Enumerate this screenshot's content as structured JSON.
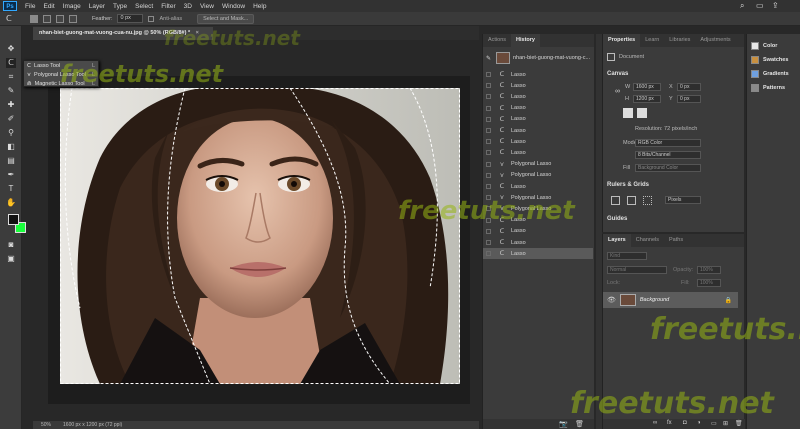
{
  "menubar": {
    "logo": "Ps",
    "items": [
      "File",
      "Edit",
      "Image",
      "Layer",
      "Type",
      "Select",
      "Filter",
      "3D",
      "View",
      "Window",
      "Help"
    ]
  },
  "options": {
    "feather_label": "Feather:",
    "feather_value": "0 px",
    "antialias_label": "Anti-alias",
    "select_mask_label": "Select and Mask..."
  },
  "document": {
    "tab_title": "nhan-biet-guong-mat-vuong-cua-nu.jpg @ 50% (RGB/8#) *",
    "zoom": "50%",
    "doc_size": "1600 px x 1200 px (72 ppi)"
  },
  "flyout": {
    "items": [
      {
        "label": "Lasso Tool",
        "key": "L"
      },
      {
        "label": "Polygonal Lasso Tool",
        "key": "L"
      },
      {
        "label": "Magnetic Lasso Tool",
        "key": "L"
      }
    ]
  },
  "history": {
    "tabs": [
      "Actions",
      "History"
    ],
    "snapshot": "nhan-biet-guong-mat-vuong-c...",
    "states": [
      "Lasso",
      "Lasso",
      "Lasso",
      "Lasso",
      "Lasso",
      "Lasso",
      "Lasso",
      "Lasso",
      "Polygonal Lasso",
      "Polygonal Lasso",
      "Lasso",
      "Polygonal Lasso",
      "Polygonal Lasso",
      "Lasso",
      "Lasso",
      "Lasso",
      "Lasso"
    ],
    "selected_index": 16
  },
  "properties": {
    "tabs": [
      "Properties",
      "Learn",
      "Libraries",
      "Adjustments"
    ],
    "doc_label": "Document",
    "canvas_head": "Canvas",
    "w_label": "W",
    "w_value": "1600 px",
    "h_label": "H",
    "h_value": "1200 px",
    "x_label": "X",
    "x_value": "0 px",
    "y_label": "Y",
    "y_value": "0 px",
    "resolution": "Resolution: 72 pixels/inch",
    "mode_label": "Mode",
    "mode_value": "RGB Color",
    "depth_value": "8 Bits/Channel",
    "fill_label": "Fill",
    "fill_value": "Background Color",
    "rulers_head": "Rulers & Grids",
    "units_value": "Pixels",
    "guides_head": "Guides"
  },
  "layers": {
    "tabs": [
      "Layers",
      "Channels",
      "Paths"
    ],
    "kind_label": "Kind",
    "blend_mode": "Normal",
    "opacity_label": "Opacity:",
    "opacity_value": "100%",
    "lock_label": "Lock:",
    "fill_label": "Fill:",
    "fill_value": "100%",
    "layer_name": "Background"
  },
  "side_panels": {
    "items": [
      {
        "label": "Color",
        "color": "#e8e8e8"
      },
      {
        "label": "Swatches",
        "color": "#c89040"
      },
      {
        "label": "Gradients",
        "color": "#6fa0e0"
      },
      {
        "label": "Patterns",
        "color": "#8a8a8a"
      }
    ]
  },
  "colors": {
    "foreground": "#111111",
    "background": "#19ff3c",
    "accent": "#31a8ff"
  },
  "watermark": "freetuts.net"
}
